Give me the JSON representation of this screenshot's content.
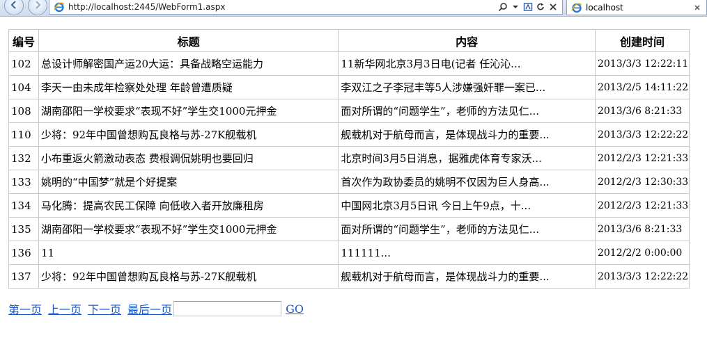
{
  "browser": {
    "url": "http://localhost:2445/WebForm1.aspx",
    "tab_title": "localhost"
  },
  "grid": {
    "headers": [
      "编号",
      "标题",
      "内容",
      "创建时间"
    ],
    "rows": [
      {
        "id": "102",
        "title": "总设计师解密国产运20大运：具备战略空运能力",
        "content": "11新华网北京3月3日电(记者  任沁沁...",
        "created": "2013/3/3 12:22:11"
      },
      {
        "id": "104",
        "title": "李天一由未成年检察处处理  年龄曾遭质疑",
        "content": "李双江之子李冠丰等5人涉嫌强奸罪一案已...",
        "created": "2013/2/5 14:11:22"
      },
      {
        "id": "108",
        "title": "湖南邵阳一学校要求“表现不好”学生交1000元押金",
        "content": "面对所谓的“问题学生”，老师的方法见仁...",
        "created": "2013/3/6 8:21:33"
      },
      {
        "id": "110",
        "title": "少将：92年中国曾想购瓦良格与苏-27K舰载机",
        "content": "舰载机对于航母而言，是体现战斗力的重要...",
        "created": "2013/3/3 12:22:22"
      },
      {
        "id": "132",
        "title": "小布重返火箭激动表态  费根调侃姚明也要回归",
        "content": "北京时间3月5日消息，据雅虎体育专家沃...",
        "created": "2012/2/3 12:21:33"
      },
      {
        "id": "133",
        "title": "姚明的“中国梦”就是个好提案",
        "content": "首次作为政协委员的姚明不仅因为巨人身高...",
        "created": "2012/2/3 12:30:33"
      },
      {
        "id": "134",
        "title": "马化腾：提高农民工保障  向低收入者开放廉租房",
        "content": "中国网北京3月5日讯  今日上午9点，十...",
        "created": "2012/2/3 12:21:33"
      },
      {
        "id": "135",
        "title": "湖南邵阳一学校要求“表现不好”学生交1000元押金",
        "content": "面对所谓的“问题学生”，老师的方法见仁...",
        "created": "2013/3/6 8:21:33"
      },
      {
        "id": "136",
        "title": "11",
        "content": "111111...",
        "created": "2012/2/2 0:00:00"
      },
      {
        "id": "137",
        "title": "少将：92年中国曾想购瓦良格与苏-27K舰载机",
        "content": "舰载机对于航母而言，是体现战斗力的重要...",
        "created": "2013/3/3 12:22:22"
      }
    ]
  },
  "pager": {
    "first": "第一页",
    "prev": "上一页",
    "next": "下一页",
    "last": "最后一页",
    "page_input_value": "",
    "go": "GO"
  },
  "colors": {
    "link": "#1a57c4",
    "grid_border": "#c8c8c8"
  }
}
